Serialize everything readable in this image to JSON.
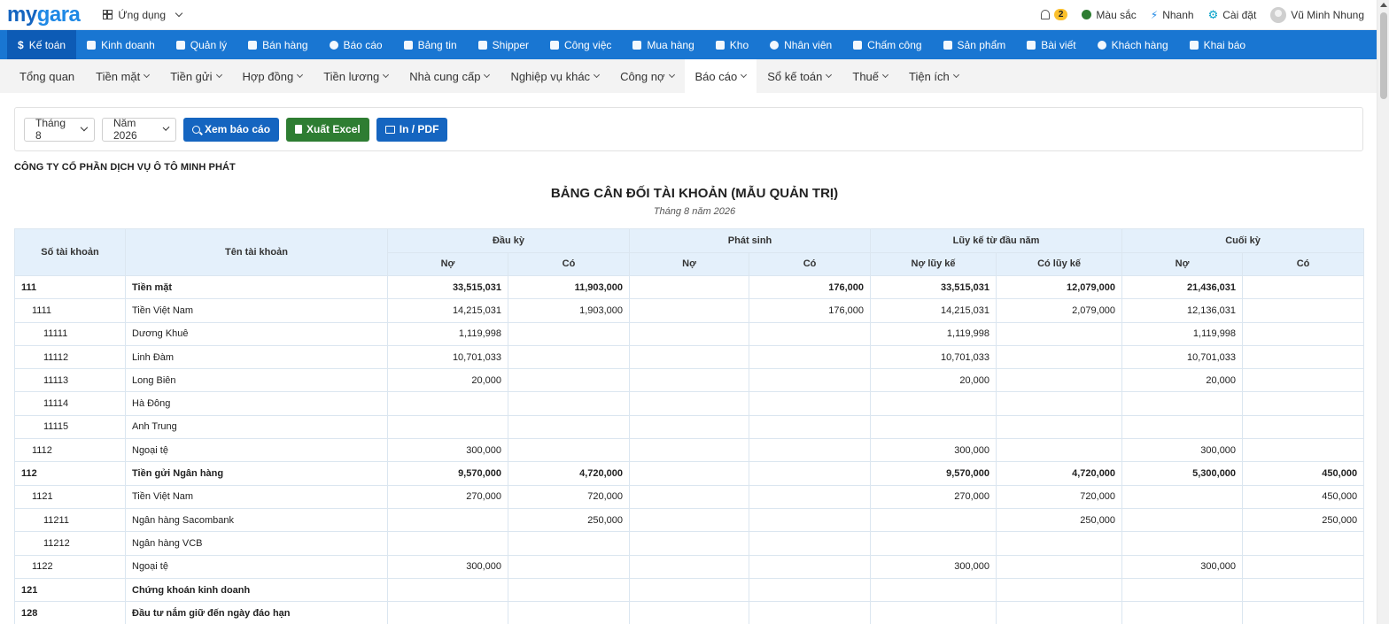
{
  "brand": {
    "part1": "my",
    "part2": "gara"
  },
  "apps_label": "Ứng dụng",
  "topright": {
    "notif_count": "2",
    "color_label": "Màu sắc",
    "quick_label": "Nhanh",
    "settings_label": "Cài đặt",
    "user_name": "Vũ Minh Nhung"
  },
  "mainnav": [
    "Kế toán",
    "Kinh doanh",
    "Quản lý",
    "Bán hàng",
    "Báo cáo",
    "Bảng tin",
    "Shipper",
    "Công việc",
    "Mua hàng",
    "Kho",
    "Nhân viên",
    "Chấm công",
    "Sản phẩm",
    "Bài viết",
    "Khách hàng",
    "Khai báo"
  ],
  "subnav": [
    "Tổng quan",
    "Tiền mặt",
    "Tiền gửi",
    "Hợp đồng",
    "Tiền lương",
    "Nhà cung cấp",
    "Nghiệp vụ khác",
    "Công nợ",
    "Báo cáo",
    "Sổ kế toán",
    "Thuế",
    "Tiện ích"
  ],
  "filters": {
    "month": "Tháng 8",
    "year": "Năm 2026",
    "view_btn": "Xem báo cáo",
    "excel_btn": "Xuất Excel",
    "print_btn": "In / PDF"
  },
  "company": "CÔNG TY CỔ PHẦN DỊCH VỤ Ô TÔ MINH PHÁT",
  "report": {
    "title": "BẢNG CÂN ĐỐI TÀI KHOẢN (MẪU QUẢN TRỊ)",
    "subtitle": "Tháng 8 năm 2026"
  },
  "table": {
    "h_code": "Số tài khoản",
    "h_name": "Tên tài khoản",
    "h_open": "Đầu kỳ",
    "h_period": "Phát sinh",
    "h_ytd": "Lũy kế từ đầu năm",
    "h_close": "Cuối kỳ",
    "h_no": "Nợ",
    "h_co": "Có",
    "h_no_lk": "Nợ lũy kế",
    "h_co_lk": "Có lũy kế",
    "rows": [
      {
        "level": 0,
        "code": "111",
        "name": "Tiền mặt",
        "v": [
          "33,515,031",
          "11,903,000",
          "",
          "176,000",
          "33,515,031",
          "12,079,000",
          "21,436,031",
          ""
        ]
      },
      {
        "level": 1,
        "code": "1111",
        "name": "Tiền Việt Nam",
        "v": [
          "14,215,031",
          "1,903,000",
          "",
          "176,000",
          "14,215,031",
          "2,079,000",
          "12,136,031",
          ""
        ]
      },
      {
        "level": 2,
        "code": "11111",
        "name": "Dương Khuê",
        "v": [
          "1,119,998",
          "",
          "",
          "",
          "1,119,998",
          "",
          "1,119,998",
          ""
        ]
      },
      {
        "level": 2,
        "code": "11112",
        "name": "Linh Đàm",
        "v": [
          "10,701,033",
          "",
          "",
          "",
          "10,701,033",
          "",
          "10,701,033",
          ""
        ]
      },
      {
        "level": 2,
        "code": "11113",
        "name": "Long Biên",
        "v": [
          "20,000",
          "",
          "",
          "",
          "20,000",
          "",
          "20,000",
          ""
        ]
      },
      {
        "level": 2,
        "code": "11114",
        "name": "Hà Đông",
        "v": [
          "",
          "",
          "",
          "",
          "",
          "",
          "",
          ""
        ]
      },
      {
        "level": 2,
        "code": "11115",
        "name": "Anh Trung",
        "v": [
          "",
          "",
          "",
          "",
          "",
          "",
          "",
          ""
        ]
      },
      {
        "level": 1,
        "code": "1112",
        "name": "Ngoại tệ",
        "v": [
          "300,000",
          "",
          "",
          "",
          "300,000",
          "",
          "300,000",
          ""
        ]
      },
      {
        "level": 0,
        "code": "112",
        "name": "Tiền gửi Ngân hàng",
        "v": [
          "9,570,000",
          "4,720,000",
          "",
          "",
          "9,570,000",
          "4,720,000",
          "5,300,000",
          "450,000"
        ]
      },
      {
        "level": 1,
        "code": "1121",
        "name": "Tiền Việt Nam",
        "v": [
          "270,000",
          "720,000",
          "",
          "",
          "270,000",
          "720,000",
          "",
          "450,000"
        ]
      },
      {
        "level": 2,
        "code": "11211",
        "name": "Ngân hàng Sacombank",
        "v": [
          "",
          "250,000",
          "",
          "",
          "",
          "250,000",
          "",
          "250,000"
        ]
      },
      {
        "level": 2,
        "code": "11212",
        "name": "Ngân hàng VCB",
        "v": [
          "",
          "",
          "",
          "",
          "",
          "",
          "",
          ""
        ]
      },
      {
        "level": 1,
        "code": "1122",
        "name": "Ngoại tệ",
        "v": [
          "300,000",
          "",
          "",
          "",
          "300,000",
          "",
          "300,000",
          ""
        ]
      },
      {
        "level": 0,
        "code": "121",
        "name": "Chứng khoán kinh doanh",
        "v": [
          "",
          "",
          "",
          "",
          "",
          "",
          "",
          ""
        ]
      },
      {
        "level": 0,
        "code": "128",
        "name": "Đầu tư nắm giữ đến ngày đáo hạn",
        "v": [
          "",
          "",
          "",
          "",
          "",
          "",
          "",
          ""
        ]
      }
    ]
  }
}
